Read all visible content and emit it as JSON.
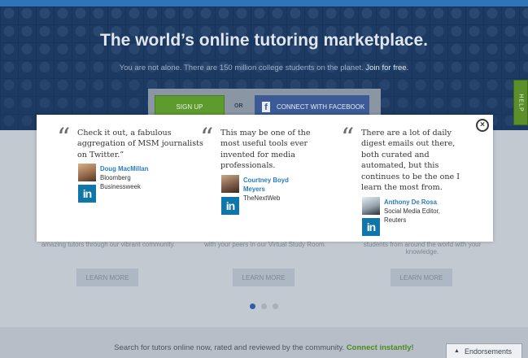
{
  "hero": {
    "title": "The world’s online tutoring marketplace.",
    "subtitle": "You are not alone. There are 150 million college students on the planet.",
    "join_link": "Join for free.",
    "signup_label": "SIGN UP",
    "or_label": "OR",
    "facebook_label": "CONNECT WITH FACEBOOK",
    "facebook_icon": "f"
  },
  "help_tab": "HELP",
  "features": [
    {
      "text": "amazing tutors through our vibrant community.",
      "cta": "LEARN MORE"
    },
    {
      "text": "with your peers in our Virtual Study Room.",
      "cta": "LEARN MORE"
    },
    {
      "text": "students from around the world with your knowledge.",
      "cta": "LEARN MORE"
    }
  ],
  "footer": {
    "text": "Search for tutors online now, rated and reviewed by the community.",
    "link": "Connect instantly!",
    "endorsements_label": "Endorsements"
  },
  "modal": {
    "close_icon": "×",
    "quotes": [
      {
        "text": "Check it out, a fabulous aggregation of MSM journalists on Twitter.”",
        "name": "Doug MacMillan",
        "org": "Bloomberg Businessweek"
      },
      {
        "text": "This may be one of the most useful tools ever invented for media professionals.",
        "name": "Courtney Boyd Meyers",
        "org": "TheNextWeb"
      },
      {
        "text": "There are a lot of daily digest emails out there, both curated and automated, but this continues to be the one I learn the most from.",
        "name": "Anthony De Rosa",
        "org": "Social Media Editor, Reuters"
      }
    ],
    "quote_mark": "“",
    "linkedin_label": "in"
  },
  "colors": {
    "hero_bg": "#1c3a62",
    "accent_green": "#5e9b2f",
    "facebook_blue": "#3b5a96",
    "linkedin_blue": "#0e76a8",
    "author_link": "#2b7bbf"
  },
  "carousel": {
    "total": 3,
    "active": 1
  }
}
